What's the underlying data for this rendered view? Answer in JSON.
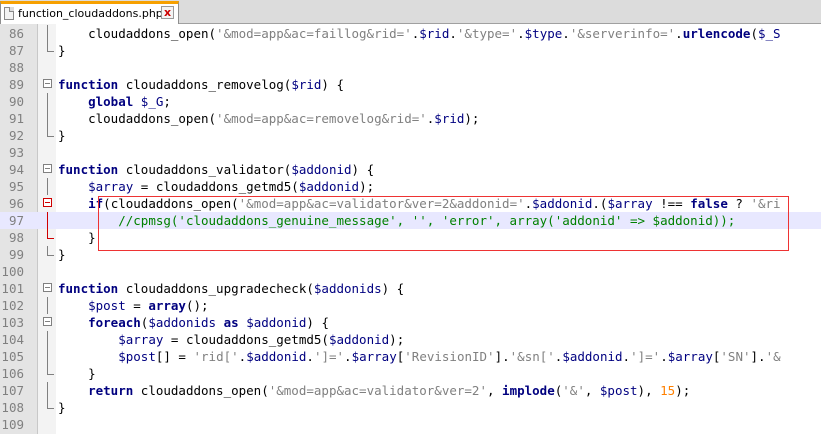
{
  "tab": {
    "title": "function_cloudaddons.php",
    "close_label": "x"
  },
  "lines": [
    {
      "n": "86",
      "html": "    cloudaddons_open(<span class=\"str\">'&amp;mod=app&amp;ac=faillog&amp;rid='</span>.<span class=\"var\">$rid</span>.<span class=\"str\">'&amp;type='</span>.<span class=\"var\">$type</span>.<span class=\"str\">'&amp;serverinfo='</span>.<span class=\"kw\">urlencode</span>(<span class=\"var\">$_S</span>"
    },
    {
      "n": "87",
      "html": "}"
    },
    {
      "n": "88",
      "html": ""
    },
    {
      "n": "89",
      "html": "<span class=\"kw\">function</span> cloudaddons_removelog(<span class=\"var\">$rid</span>) {"
    },
    {
      "n": "90",
      "html": "    <span class=\"kw\">global</span> <span class=\"var\">$_G</span>;"
    },
    {
      "n": "91",
      "html": "    cloudaddons_open(<span class=\"str\">'&amp;mod=app&amp;ac=removelog&amp;rid='</span>.<span class=\"var\">$rid</span>);"
    },
    {
      "n": "92",
      "html": "}"
    },
    {
      "n": "93",
      "html": ""
    },
    {
      "n": "94",
      "html": "<span class=\"kw\">function</span> cloudaddons_validator(<span class=\"var\">$addonid</span>) {"
    },
    {
      "n": "95",
      "html": "    <span class=\"var\">$array</span> = cloudaddons_getmd5(<span class=\"var\">$addonid</span>);"
    },
    {
      "n": "96",
      "html": "    <span class=\"kw\">if</span>(cloudaddons_open(<span class=\"str\">'&amp;mod=app&amp;ac=validator&amp;ver=2&amp;addonid='</span>.<span class=\"var\">$addonid</span>.(<span class=\"var\">$array</span> !== <span class=\"kw\">false</span> ? <span class=\"str\">'&amp;ri</span>"
    },
    {
      "n": "97",
      "html": "        <span class=\"cmt\">//cpmsg('cloudaddons_genuine_message', '', 'error', array('addonid' =&gt; $addonid));</span>"
    },
    {
      "n": "98",
      "html": "    }"
    },
    {
      "n": "99",
      "html": "}"
    },
    {
      "n": "100",
      "html": ""
    },
    {
      "n": "101",
      "html": "<span class=\"kw\">function</span> cloudaddons_upgradecheck(<span class=\"var\">$addonids</span>) {"
    },
    {
      "n": "102",
      "html": "    <span class=\"var\">$post</span> = <span class=\"kw\">array</span>();"
    },
    {
      "n": "103",
      "html": "    <span class=\"kw\">foreach</span>(<span class=\"var\">$addonids</span> <span class=\"kw\">as</span> <span class=\"var\">$addonid</span>) {"
    },
    {
      "n": "104",
      "html": "        <span class=\"var\">$array</span> = cloudaddons_getmd5(<span class=\"var\">$addonid</span>);"
    },
    {
      "n": "105",
      "html": "        <span class=\"var\">$post</span>[] = <span class=\"str\">'rid['</span>.<span class=\"var\">$addonid</span>.<span class=\"str\">']='</span>.<span class=\"var\">$array</span>[<span class=\"str\">'RevisionID'</span>].<span class=\"str\">'&amp;sn['</span>.<span class=\"var\">$addonid</span>.<span class=\"str\">']='</span>.<span class=\"var\">$array</span>[<span class=\"str\">'SN'</span>].<span class=\"str\">'&amp;</span>"
    },
    {
      "n": "106",
      "html": "    }"
    },
    {
      "n": "107",
      "html": "    <span class=\"kw\">return</span> cloudaddons_open(<span class=\"str\">'&amp;mod=app&amp;ac=validator&amp;ver=2'</span>, <span class=\"kw\">implode</span>(<span class=\"str\">'&amp;'</span>, <span class=\"var\">$post</span>), <span class=\"num\">15</span>);"
    },
    {
      "n": "108",
      "html": "}"
    },
    {
      "n": "109",
      "html": ""
    }
  ]
}
